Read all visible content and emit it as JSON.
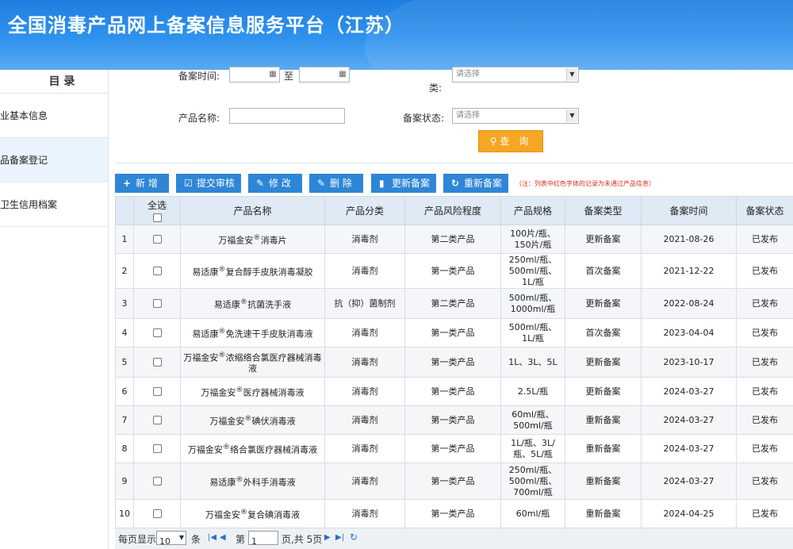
{
  "header": {
    "title": "全国消毒产品网上备案信息服务平台（江苏）"
  },
  "sidebar": {
    "title": "目 录",
    "items": [
      {
        "label": "企业基本信息"
      },
      {
        "label": "产品备案登记"
      },
      {
        "label": "的卫生信用档案"
      }
    ]
  },
  "search": {
    "date_label": "备案时间:",
    "date_to": "至",
    "category_label": "类:",
    "category_placeholder": "请选择",
    "product_name_label": "产品名称:",
    "status_label": "备案状态:",
    "status_placeholder": "请选择",
    "query_button": "查 询"
  },
  "toolbar": {
    "add": "新 增",
    "submit": "提交审核",
    "edit": "修 改",
    "delete": "删 除",
    "update": "更新备案",
    "rerecord": "重新备案",
    "note": "（注：列表中红色字体的记录为未通过产品信息）"
  },
  "table": {
    "select_all": "全选",
    "columns": [
      "产品名称",
      "产品分类",
      "产品风险程度",
      "产品规格",
      "备案类型",
      "备案时间",
      "备案状态"
    ],
    "rows": [
      {
        "no": "1",
        "name": "万福金安",
        "sup": "®",
        "name_suffix": "消毒片",
        "category": "消毒剂",
        "risk": "第二类产品",
        "spec": "100片/瓶、150片/瓶",
        "type": "更新备案",
        "date": "2021-08-26",
        "status": "已发布"
      },
      {
        "no": "2",
        "name": "易适康",
        "sup": "®",
        "name_suffix": "复合醇手皮肤消毒凝胶",
        "category": "消毒剂",
        "risk": "第一类产品",
        "spec": "250ml/瓶、500ml/瓶、1L/瓶",
        "type": "首次备案",
        "date": "2021-12-22",
        "status": "已发布"
      },
      {
        "no": "3",
        "name": "易适康",
        "sup": "®",
        "name_suffix": "抗菌洗手液",
        "category": "抗（抑）菌制剂",
        "risk": "第二类产品",
        "spec": "500ml/瓶、1000ml/瓶",
        "type": "更新备案",
        "date": "2022-08-24",
        "status": "已发布"
      },
      {
        "no": "4",
        "name": "易适康",
        "sup": "®",
        "name_suffix": "免洗速干手皮肤消毒液",
        "category": "消毒剂",
        "risk": "第一类产品",
        "spec": "500ml/瓶、1L/瓶",
        "type": "首次备案",
        "date": "2023-04-04",
        "status": "已发布"
      },
      {
        "no": "5",
        "name": "万福金安",
        "sup": "®",
        "name_suffix": "浓缩络合氯医疗器械消毒液",
        "category": "消毒剂",
        "risk": "第一类产品",
        "spec": "1L、3L、5L",
        "type": "更新备案",
        "date": "2023-10-17",
        "status": "已发布"
      },
      {
        "no": "6",
        "name": "万福金安",
        "sup": "®",
        "name_suffix": "医疗器械消毒液",
        "category": "消毒剂",
        "risk": "第一类产品",
        "spec": "2.5L/瓶",
        "type": "更新备案",
        "date": "2024-03-27",
        "status": "已发布"
      },
      {
        "no": "7",
        "name": "万福金安",
        "sup": "®",
        "name_suffix": "碘伏消毒液",
        "category": "消毒剂",
        "risk": "第一类产品",
        "spec": "60ml/瓶、500ml/瓶",
        "type": "重新备案",
        "date": "2024-03-27",
        "status": "已发布"
      },
      {
        "no": "8",
        "name": "万福金安",
        "sup": "®",
        "name_suffix": "络合氯医疗器械消毒液",
        "category": "消毒剂",
        "risk": "第一类产品",
        "spec": "1L/瓶、3L/瓶、5L/瓶",
        "type": "重新备案",
        "date": "2024-03-27",
        "status": "已发布"
      },
      {
        "no": "9",
        "name": "易适康",
        "sup": "®",
        "name_suffix": "外科手消毒液",
        "category": "消毒剂",
        "risk": "第一类产品",
        "spec": "250ml/瓶、500ml/瓶、700ml/瓶",
        "type": "重新备案",
        "date": "2024-03-27",
        "status": "已发布"
      },
      {
        "no": "10",
        "name": "万福金安",
        "sup": "®",
        "name_suffix": "复合碘消毒液",
        "category": "消毒剂",
        "risk": "第一类产品",
        "spec": "60ml/瓶",
        "type": "重新备案",
        "date": "2024-04-25",
        "status": "已发布"
      }
    ]
  },
  "pager": {
    "per_page_label": "每页显示",
    "per_page_value": "10",
    "per_page_unit": "条",
    "page_prefix": "第",
    "page_value": "1",
    "page_suffix": "页,共 5页"
  }
}
